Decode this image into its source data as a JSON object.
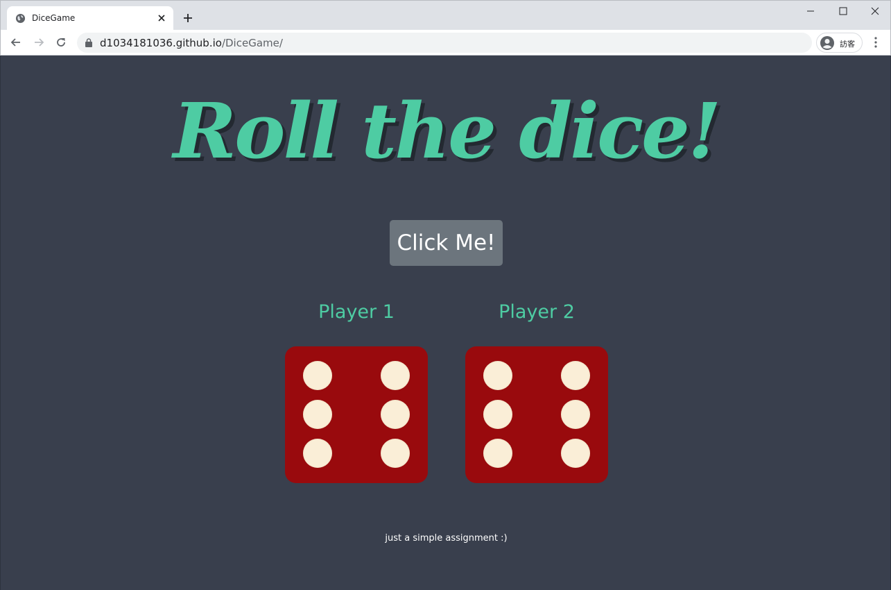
{
  "browser": {
    "tab_title": "DiceGame",
    "url_host": "d1034181036.github.io",
    "url_path": "/DiceGame/",
    "profile_label": "訪客"
  },
  "page": {
    "heading": "Roll the dice!",
    "button_label": "Click Me!",
    "players": [
      {
        "label": "Player 1",
        "die_value": 6
      },
      {
        "label": "Player 2",
        "die_value": 6
      }
    ],
    "footer": "just a simple assignment :)"
  },
  "colors": {
    "background": "#393f4d",
    "accent": "#4ecca3",
    "die": "#990a0d",
    "pip": "#faeed7",
    "button": "#6c757d"
  }
}
